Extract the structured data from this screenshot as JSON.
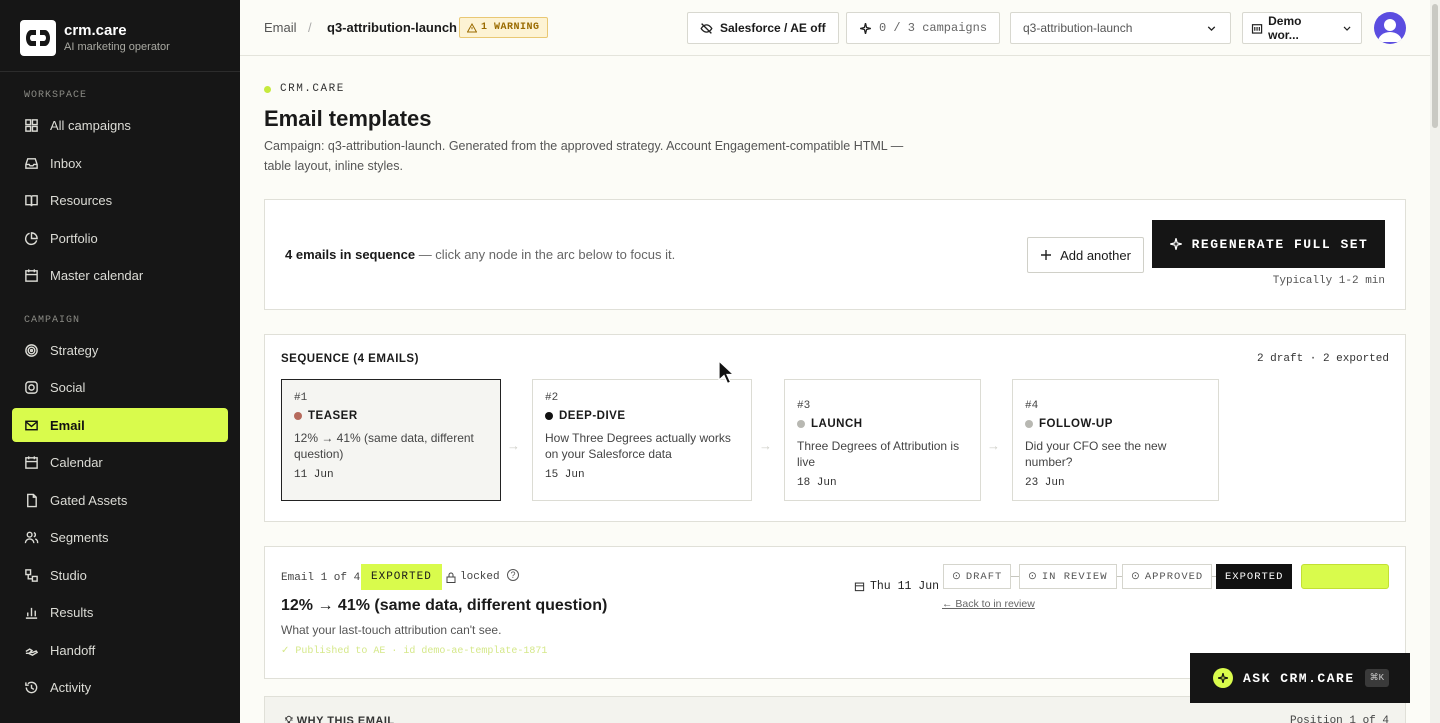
{
  "brand": {
    "name": "crm.care",
    "tagline": "AI marketing operator"
  },
  "sidebar": {
    "workspace_label": "WORKSPACE",
    "workspace_items": [
      {
        "label": "All campaigns",
        "icon": "grid-icon"
      },
      {
        "label": "Inbox",
        "icon": "inbox-icon"
      },
      {
        "label": "Resources",
        "icon": "book-icon"
      },
      {
        "label": "Portfolio",
        "icon": "pie-chart-icon"
      },
      {
        "label": "Master calendar",
        "icon": "calendar-icon"
      }
    ],
    "campaign_label": "CAMPAIGN",
    "campaign_items": [
      {
        "label": "Strategy",
        "icon": "target-icon"
      },
      {
        "label": "Social",
        "icon": "instagram-icon"
      },
      {
        "label": "Email",
        "icon": "mail-icon",
        "active": true
      },
      {
        "label": "Calendar",
        "icon": "calendar-icon"
      },
      {
        "label": "Gated Assets",
        "icon": "file-icon"
      },
      {
        "label": "Segments",
        "icon": "users-icon"
      },
      {
        "label": "Studio",
        "icon": "workflow-icon"
      },
      {
        "label": "Results",
        "icon": "bar-chart-icon"
      },
      {
        "label": "Handoff",
        "icon": "hand-icon"
      },
      {
        "label": "Activity",
        "icon": "history-icon"
      }
    ]
  },
  "topbar": {
    "breadcrumb_root": "Email",
    "breadcrumb_sep": "/",
    "breadcrumb_current": "q3-attribution-launch",
    "warning": "1 WARNING",
    "salesforce": "Salesforce / AE off",
    "campaigns_count": "0 / 3 campaigns",
    "campaign_select": "q3-attribution-launch",
    "workspace_select": "Demo wor..."
  },
  "page": {
    "eyebrow": "CRM.CARE",
    "title": "Email templates",
    "description": "Campaign: q3-attribution-launch. Generated from the approved strategy. Account Engagement-compatible HTML — table layout, inline styles."
  },
  "summary": {
    "count_bold": "4 emails in sequence",
    "count_rest": " — click any node in the arc below to focus it.",
    "add_label": "Add another",
    "regen_label": "REGENERATE FULL SET",
    "regen_note": "Typically 1-2 min"
  },
  "sequence": {
    "title": "SEQUENCE (4 EMAILS)",
    "meta": "2 draft · 2 exported",
    "arrow": "→",
    "nodes": [
      {
        "num": "#1",
        "tag": "TEASER",
        "subject": "12% → 41% (same data, different question)",
        "date": "11 Jun",
        "dot_color": "#b66a5c"
      },
      {
        "num": "#2",
        "tag": "DEEP-DIVE",
        "subject": "How Three Degrees actually works on your Salesforce data",
        "date": "15 Jun",
        "dot_color": "#111111"
      },
      {
        "num": "#3",
        "tag": "LAUNCH",
        "subject": "Three Degrees of Attribution is live",
        "date": "18 Jun",
        "dot_color": "#b8b8b2"
      },
      {
        "num": "#4",
        "tag": "FOLLOW-UP",
        "subject": "Did your CFO see the new number?",
        "date": "23 Jun",
        "dot_color": "#b8b8b2"
      }
    ]
  },
  "email": {
    "count": "Email 1 of 4",
    "status": "EXPORTED",
    "locked": "locked",
    "help": "?",
    "title": "12% → 41% (same data, different question)",
    "preheader": "What your last-touch attribution can't see.",
    "published": "✓ Published to AE · id demo-ae-template-1871",
    "date": "Thu 11 Jun",
    "stages": [
      "DRAFT",
      "IN REVIEW",
      "APPROVED",
      "EXPORTED"
    ],
    "back_link": "← Back to in review"
  },
  "why": {
    "title": "WHY THIS EMAIL",
    "position": "Position 1 of 4"
  },
  "ask": {
    "label": "ASK CRM.CARE",
    "shortcut": "⌘K"
  },
  "colors": {
    "accent": "#d9fb4c",
    "sidebar_bg": "#161616",
    "page_bg": "#fcfcf7"
  }
}
